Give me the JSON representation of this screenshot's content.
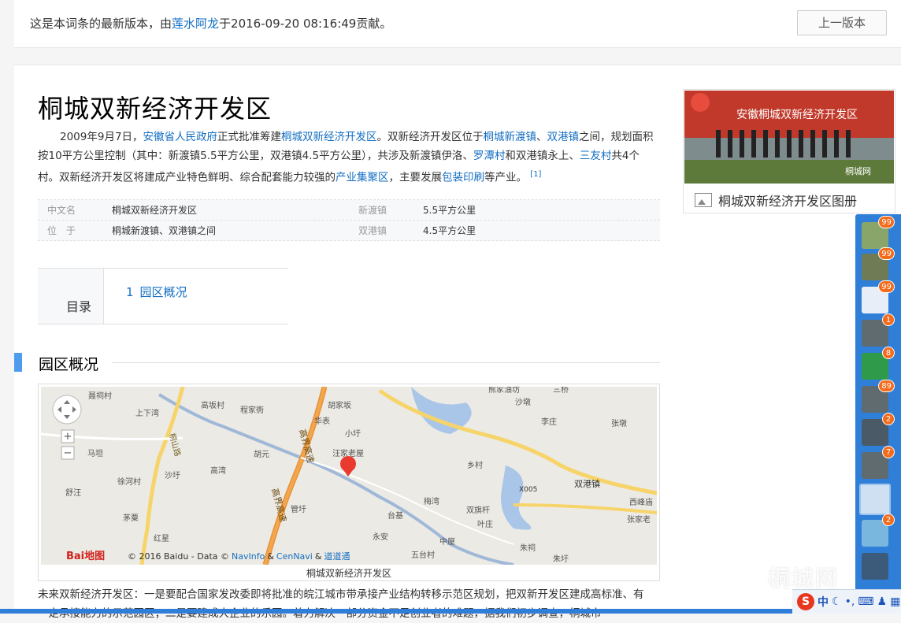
{
  "version_bar": {
    "prefix": "这是本词条的最新版本，由",
    "author": "莲水阿龙",
    "suffix": "于2016-09-20 08:16:49贡献。",
    "prev_button": "上一版本"
  },
  "article": {
    "title": "桐城双新经济开发区",
    "summary": {
      "t1": "2009年9月7日，",
      "l1": "安徽省人民政府",
      "t2": "正式批准筹建",
      "l2": "桐城双新经济开发区",
      "t3": "。双新经济开发区位于",
      "l3": "桐城新渡镇",
      "t4": "、",
      "l4": "双港镇",
      "t5": "之间，规划面积按10平方公里控制（其中：新渡镇5.5平方公里，双港镇4.5平方公里），共涉及新渡镇伊洛、",
      "l5": "罗潭村",
      "t6": "和双港镇永上、",
      "l6": "三友村",
      "t7": "共4个村。双新经济开发区将建成产业特色鲜明、综合配套能力较强的",
      "l7": "产业集聚区",
      "t8": "，主要发展",
      "l8": "包装印刷",
      "t9": "等产业。",
      "ref": "[1]"
    },
    "infobox": [
      {
        "k1": "中文名",
        "v1": "桐城双新经济开发区",
        "k2": "新渡镇",
        "v2": "5.5平方公里"
      },
      {
        "k1": "位　于",
        "v1": "桐城新渡镇、双港镇之间",
        "k2": "双港镇",
        "v2": "4.5平方公里"
      }
    ],
    "toc": {
      "label": "目录",
      "items": [
        {
          "num": "1",
          "text": "园区概况"
        }
      ]
    },
    "section": {
      "title": "园区概况"
    },
    "map": {
      "caption": "桐城双新经济开发区",
      "copyright_pre": "© 2016 Baidu - Data ©",
      "navinfo": "NavInfo",
      "amp1": "&",
      "cennavi": "CenNavi",
      "amp2": "&",
      "daodaotong": "道道通",
      "logo_text": "Bai地图",
      "zoom_in": "+",
      "zoom_out": "−",
      "labels": [
        "聂祠村",
        "上下湾",
        "高坂村",
        "程家衖",
        "胡家坂",
        "华表",
        "熊家油坊",
        "沙墩",
        "三桥",
        "李庄",
        "张墩",
        "马坦",
        "小圩",
        "汪家老屋",
        "胡元",
        "高湾",
        "徐河村",
        "沙圩",
        "舒汪",
        "茅粟",
        "红星",
        "乡村",
        "双港镇",
        "西峰庙",
        "张家老",
        "梅湾",
        "双旗杆",
        "叶庄",
        "台基",
        "管圩",
        "永安",
        "中屋",
        "朱祠",
        "五台村",
        "朱圩",
        "X005"
      ],
      "roads": [
        "桐山路",
        "高界高速",
        "高界高速"
      ]
    },
    "para2": "未来双新经济开发区：一是要配合国家发改委即将批准的皖江城市带承接产业结构转移示范区规划，把双新开发区建成高标准、有一定承接能力的示范园区；二是要建成大企业的乐园。着力解决一部分资金不足创业者的难题，据我们初步调查，桐城市"
  },
  "album": {
    "label": "桐城双新经济开发区图册",
    "banner": "安徽桐城双新经济开发区",
    "watermark": "桐城网"
  },
  "dock": {
    "badges": [
      "99",
      "99",
      "99",
      "1",
      "8",
      "89",
      "2",
      "7",
      "",
      "2"
    ]
  },
  "tray": {
    "s": "S",
    "zh": "中"
  },
  "watermark": "桐城网"
}
